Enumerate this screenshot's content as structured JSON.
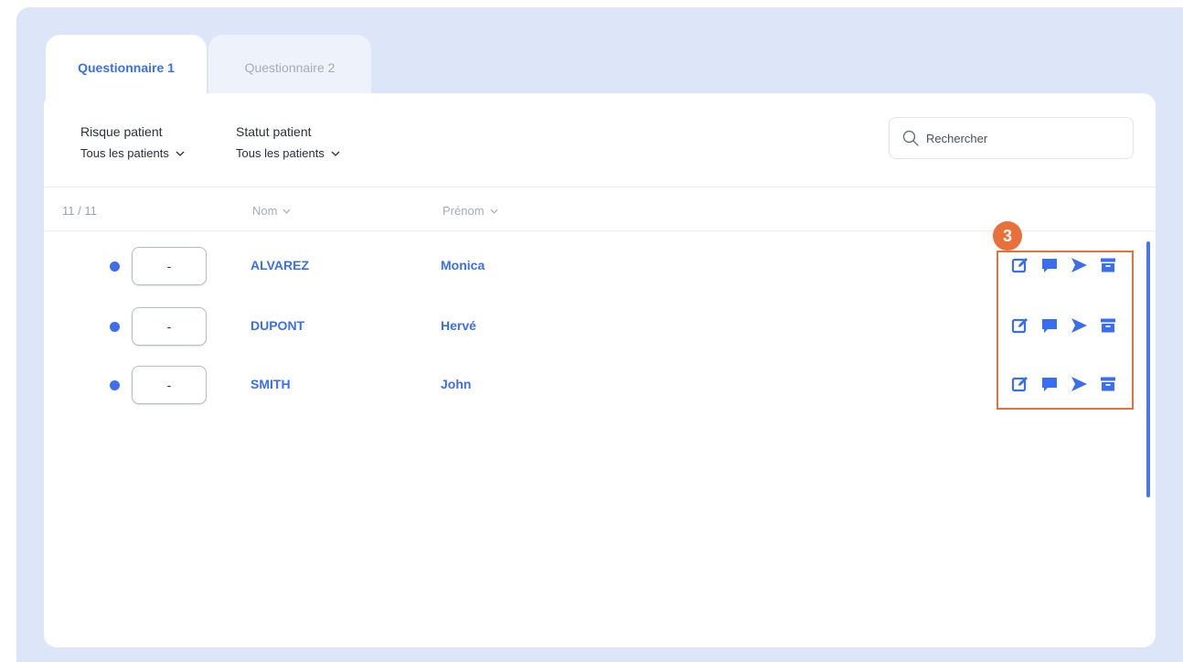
{
  "tabs": [
    {
      "label": "Questionnaire 1",
      "active": true
    },
    {
      "label": "Questionnaire 2",
      "active": false
    }
  ],
  "filters": {
    "risk": {
      "label": "Risque patient",
      "value": "Tous les patients"
    },
    "status": {
      "label": "Statut patient",
      "value": "Tous les patients"
    }
  },
  "search": {
    "placeholder": "Rechercher"
  },
  "table": {
    "count": "11 / 11",
    "columns": {
      "nom": "Nom",
      "prenom": "Prénom"
    },
    "rows": [
      {
        "risk": "-",
        "nom": "ALVAREZ",
        "prenom": "Monica"
      },
      {
        "risk": "-",
        "nom": "DUPONT",
        "prenom": "Hervé"
      },
      {
        "risk": "-",
        "nom": "SMITH",
        "prenom": "John"
      }
    ]
  },
  "annotation": {
    "step": "3"
  },
  "icons": [
    "chevron-down-icon",
    "search-icon",
    "status-dot-icon",
    "edit-icon",
    "comment-icon",
    "send-icon",
    "archive-icon"
  ],
  "colors": {
    "accent": "#3a6ef0",
    "background": "#dde6f9",
    "annotation": "#e8703a",
    "muted": "#a5acb8"
  }
}
